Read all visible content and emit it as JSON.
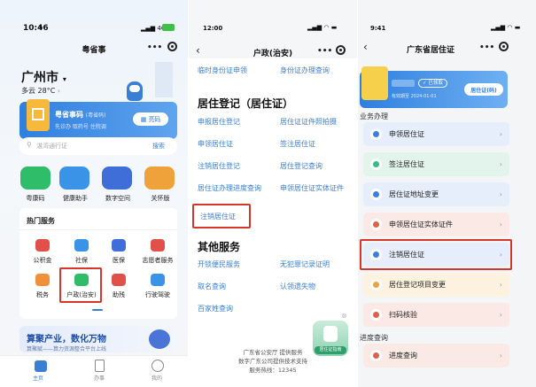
{
  "panel1": {
    "status_time": "10:46",
    "signal": "4G",
    "app_title": "粤省事",
    "capsule_more": "•••",
    "city": "广州市",
    "weather": "多云 28°C",
    "card_title": "粤省事码",
    "card_sub": "(粤省码)",
    "card_desc": "先诊办  取药号  住院调",
    "card_btn": "亮码",
    "search_placeholder": "湛湾通行证",
    "search_btn": "搜索",
    "top_icons": [
      {
        "label": "粤康码",
        "color": "#2fbd6a"
      },
      {
        "label": "健康助手",
        "color": "#3b93e8"
      },
      {
        "label": "数字空间",
        "color": "#3f6ed8"
      },
      {
        "label": "关怀版",
        "color": "#f0a23a"
      }
    ],
    "hot_title": "热门服务",
    "services": [
      {
        "label": "公积金",
        "color": "#e2504a"
      },
      {
        "label": "社保",
        "color": "#3b93e8"
      },
      {
        "label": "医保",
        "color": "#3f6ed8"
      },
      {
        "label": "志愿者服务",
        "color": "#e2504a"
      },
      {
        "label": "税务",
        "color": "#f0903a"
      },
      {
        "label": "户政(治安)",
        "color": "#2fbd6a"
      },
      {
        "label": "助残",
        "color": "#e2504a"
      },
      {
        "label": "行驶驾驶",
        "color": "#3b93e8"
      }
    ],
    "banner_title": "算聚产业，数化万物",
    "banner_sub": "算聚赋——算力资源整合平台上线",
    "tabs": [
      {
        "label": "主页",
        "active": true
      },
      {
        "label": "办事",
        "active": false
      },
      {
        "label": "我的",
        "active": false
      }
    ]
  },
  "panel2": {
    "status_time": "12:00",
    "title": "户政(治安)",
    "capsule_more": "•••",
    "top_links": [
      "临时身份证申领",
      "身份证办理查询"
    ],
    "section1_title": "居住登记（居住证）",
    "section1_links": [
      "申报居住登记",
      "居住证证件照拍摄",
      "申领居住证",
      "签注居住证",
      "注销居住登记",
      "居住登记查询",
      "居住证办理进度查询",
      "申领居住证实体证件",
      "注销居住证"
    ],
    "section2_title": "其他服务",
    "section2_links": [
      "开锁便民服务",
      "无犯罪记录证明",
      "取名查询",
      "认领遗失物",
      "百家姓查询"
    ],
    "footer": [
      "广东省公安厅 提供服务",
      "数字广东公司提供技术支持",
      "服务热线：12345"
    ],
    "float_label": "居住证指南"
  },
  "panel3": {
    "status_time": "9:41",
    "title": "广东省居住证",
    "capsule_more": "•••",
    "card_name": "■■ ■■■",
    "card_tag": "已领取",
    "card_valid": "有效期至 2024-01-01",
    "card_btn": "居住证(码)",
    "section1_title": "业务办理",
    "rows": [
      {
        "label": "申领居住证",
        "bg": "#e6eefb",
        "ic": "#3b7fe0"
      },
      {
        "label": "签注居住证",
        "bg": "#e3f4ec",
        "ic": "#2fbd8a"
      },
      {
        "label": "居住证地址变更",
        "bg": "#e6eefb",
        "ic": "#3b7fe0"
      },
      {
        "label": "申领居住证实体证件",
        "bg": "#fbe9e6",
        "ic": "#e2604a"
      },
      {
        "label": "注销居住证",
        "bg": "#e6eefb",
        "ic": "#3b7fe0"
      },
      {
        "label": "居住登记项目变更",
        "bg": "#fdf1e0",
        "ic": "#f0a23a"
      },
      {
        "label": "扫码核验",
        "bg": "#fbe9e6",
        "ic": "#e2604a"
      }
    ],
    "section2_title": "进度查询",
    "progress_row": {
      "label": "进度查询",
      "bg": "#fbe9e6",
      "ic": "#e2604a"
    }
  }
}
